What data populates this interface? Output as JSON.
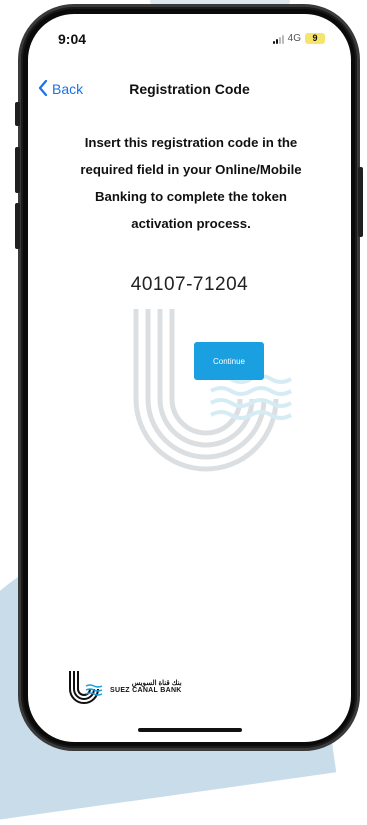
{
  "status_bar": {
    "time": "9:04",
    "network": "4G",
    "battery": "9"
  },
  "nav": {
    "back_label": "Back",
    "title": "Registration Code"
  },
  "main": {
    "instruction": "Insert this registration code in the required field in your Online/Mobile Banking to complete the token activation process.",
    "registration_code": "40107-71204",
    "continue_label": "Continue"
  },
  "footer": {
    "logo_arabic": "بنك قناة السويس",
    "logo_english": "SUEZ CANAL BANK"
  },
  "colors": {
    "accent": "#1a73e8",
    "button": "#1a9fe0",
    "watermark": "#d9dde0"
  }
}
